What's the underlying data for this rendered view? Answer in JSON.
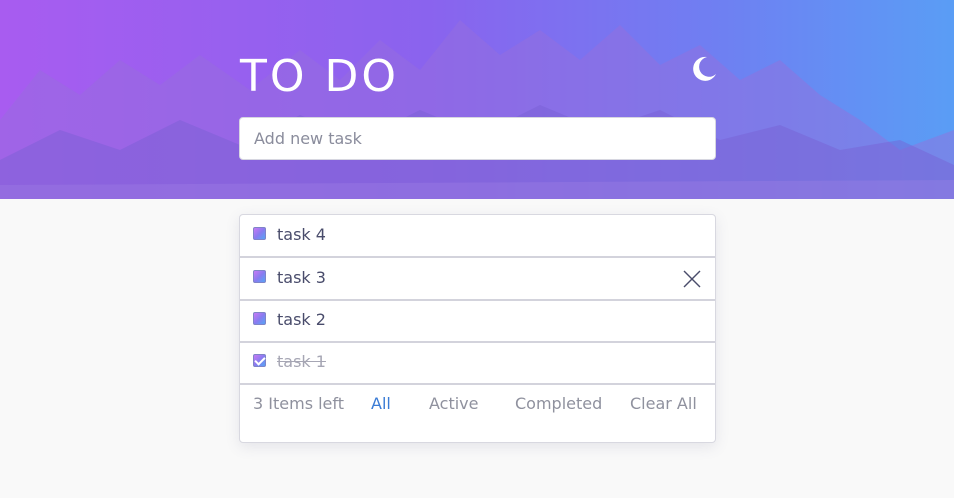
{
  "header": {
    "title": "TO DO",
    "theme_toggle_icon": "moon-icon"
  },
  "new_task": {
    "placeholder": "Add new task",
    "value": ""
  },
  "tasks": [
    {
      "label": "task 4",
      "completed": false
    },
    {
      "label": "task 3",
      "completed": false,
      "hovered": true
    },
    {
      "label": "task 2",
      "completed": false
    },
    {
      "label": "task 1",
      "completed": true
    }
  ],
  "footer": {
    "items_left": "3 Items left",
    "filters": [
      "All",
      "Active",
      "Completed"
    ],
    "active_filter": "All",
    "clear_label": "Clear All"
  },
  "colors": {
    "accent": "#3a7bd5",
    "gradient_start": "#a85cf0",
    "gradient_end": "#5a9df5",
    "text": "#494c6b",
    "muted": "#8f919e"
  }
}
